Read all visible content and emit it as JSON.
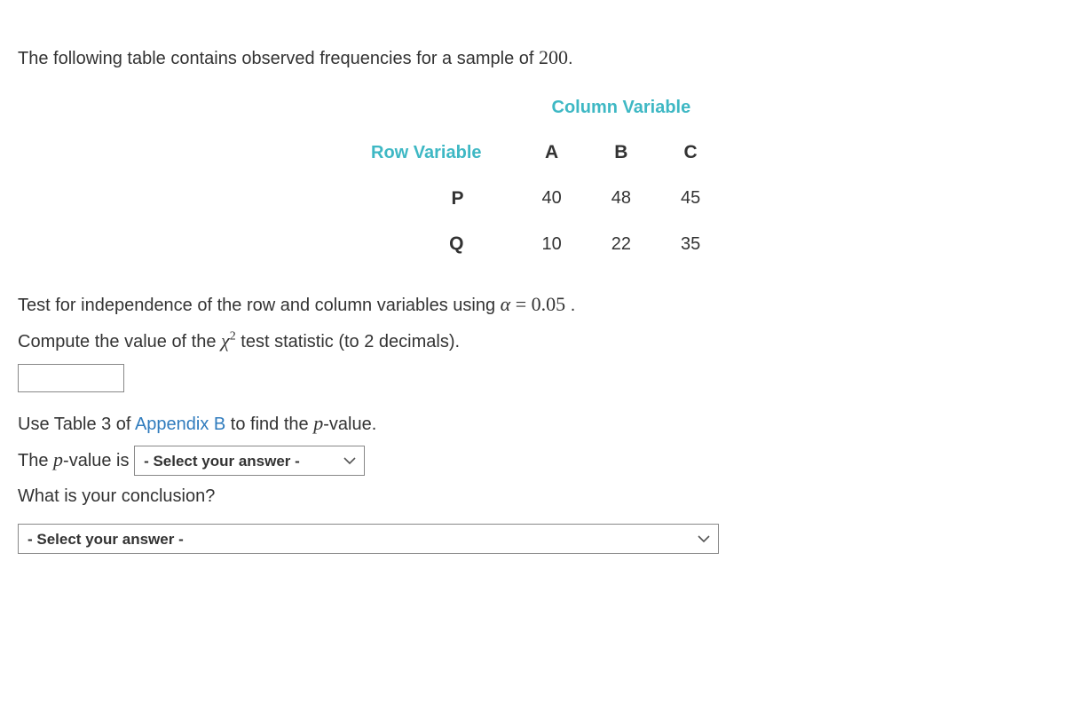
{
  "intro": {
    "prefix": "The following table contains observed frequencies for a sample of ",
    "sample_size": "200",
    "suffix": "."
  },
  "table": {
    "column_variable_label": "Column Variable",
    "row_variable_label": "Row Variable",
    "columns": [
      "A",
      "B",
      "C"
    ],
    "rows": [
      {
        "label": "P",
        "values": [
          "40",
          "48",
          "45"
        ]
      },
      {
        "label": "Q",
        "values": [
          "10",
          "22",
          "35"
        ]
      }
    ]
  },
  "q1": {
    "prefix": "Test for independence of the row and column variables using ",
    "alpha_sym": "α",
    "eq": " = ",
    "alpha_val": "0.05",
    "suffix": " ."
  },
  "q2": {
    "prefix": "Compute the value of the ",
    "chi": "χ",
    "exp": "2",
    "suffix": " test statistic (to 2 decimals)."
  },
  "q3": {
    "prefix": "Use Table 3 of ",
    "link": "Appendix B",
    "mid": " to find the ",
    "pvar": "p",
    "suffix": "-value."
  },
  "q4": {
    "prefix": "The ",
    "pvar": "p",
    "suffix": "-value is"
  },
  "q5": "What is your conclusion?",
  "selects": {
    "placeholder": "- Select your answer -"
  },
  "chart_data": {
    "type": "table",
    "title": "Observed frequencies",
    "columns": [
      "A",
      "B",
      "C"
    ],
    "rows": [
      "P",
      "Q"
    ],
    "values": [
      [
        40,
        48,
        45
      ],
      [
        10,
        22,
        35
      ]
    ],
    "sample_size": 200
  }
}
